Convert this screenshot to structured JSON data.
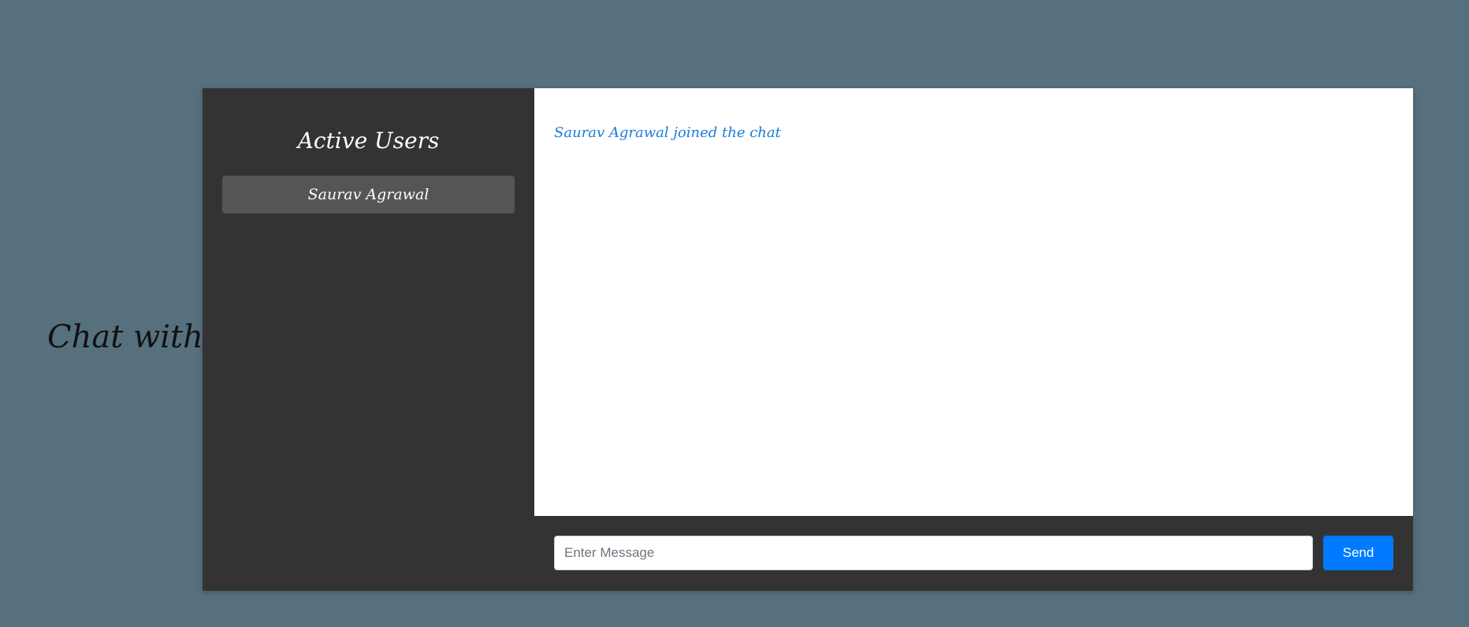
{
  "page": {
    "side_title": "Chat with me"
  },
  "sidebar": {
    "title": "Active Users",
    "users": [
      {
        "name": "Saurav Agrawal"
      }
    ]
  },
  "messages": [
    {
      "type": "system",
      "text": "Saurav Agrawal joined the chat"
    }
  ],
  "composer": {
    "placeholder": "Enter Message",
    "value": "",
    "send_label": "Send"
  },
  "colors": {
    "background": "#57707e",
    "panel": "#333333",
    "user_item": "#555555",
    "system_message": "#1a7bdc",
    "send_button": "#007bff"
  }
}
